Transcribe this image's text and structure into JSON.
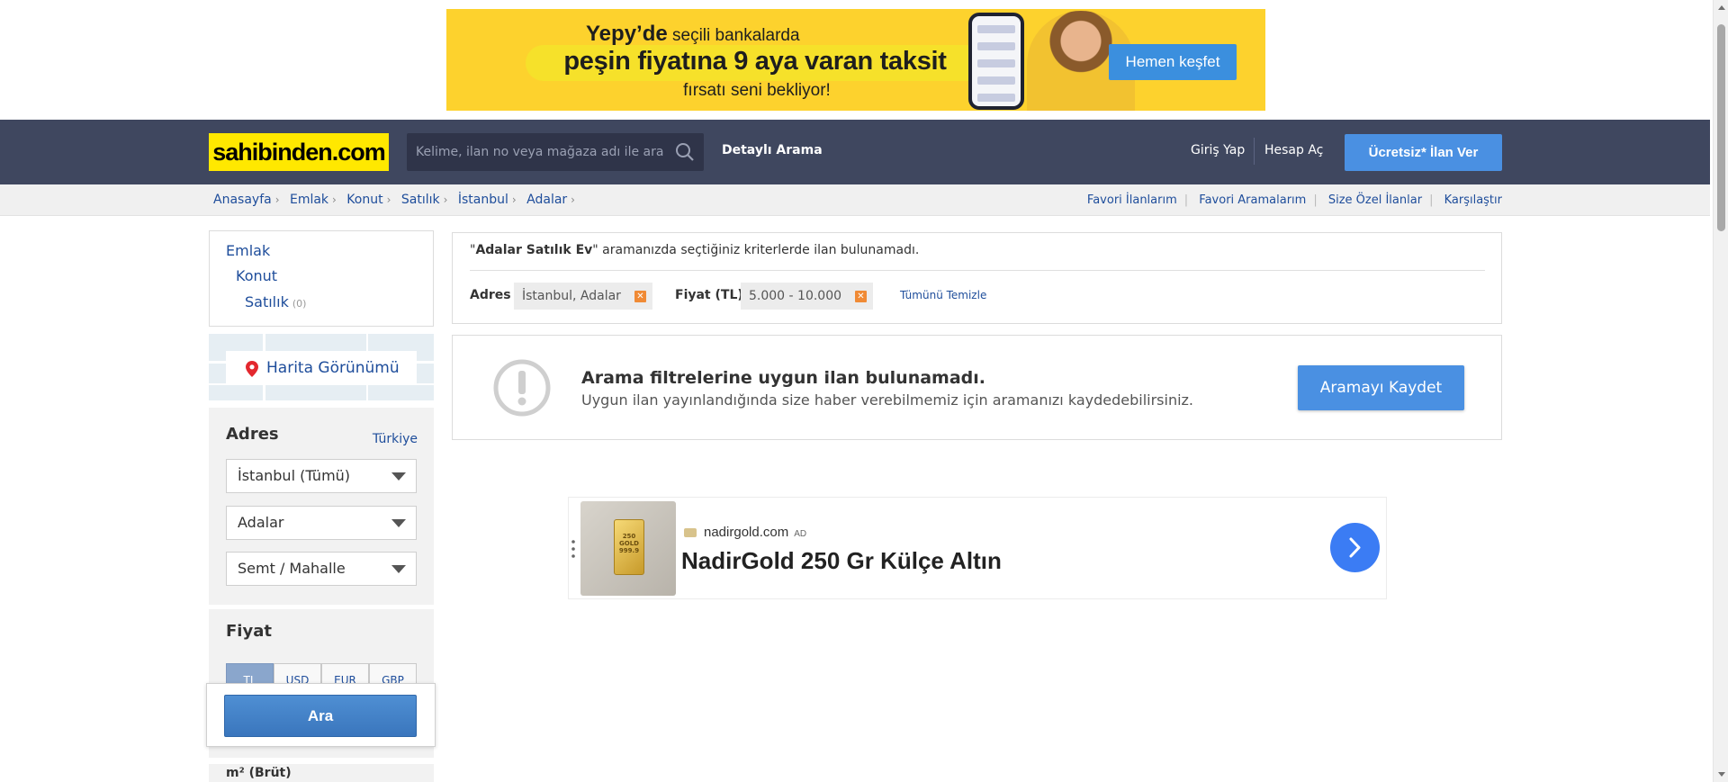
{
  "top_ad": {
    "line1_brand": "Yepy’de",
    "line1_rest": " seçili bankalarda",
    "line2": "peşin fiyatına 9 aya varan taksit",
    "line3": "fırsatı seni bekliyor!",
    "cta": "Hemen keşfet",
    "color": "#fdd22d"
  },
  "header": {
    "logo": "sahibinden.com",
    "search_placeholder": "Kelime, ilan no veya mağaza adı ile ara",
    "detailed_search": "Detaylı Arama",
    "login": "Giriş Yap",
    "register": "Hesap Aç",
    "post_ad": "Ücretsiz* İlan Ver",
    "bg_color": "#3f475f",
    "logo_color": "#ffe800"
  },
  "breadcrumb": [
    "Anasayfa",
    "Emlak",
    "Konut",
    "Satılık",
    "İstanbul",
    "Adalar"
  ],
  "quick_links": [
    "Favori İlanlarım",
    "Favori Aramalarım",
    "Size Özel İlanlar",
    "Karşılaştır"
  ],
  "sidebar": {
    "categories": {
      "level1": "Emlak",
      "level2": "Konut",
      "level3": "Satılık",
      "level3_count": "(0)"
    },
    "map_view": "Harita Görünümü",
    "address": {
      "title": "Adres",
      "country": "Türkiye",
      "city": "İstanbul (Tümü)",
      "district": "Adalar",
      "neighborhood": "Semt / Mahalle"
    },
    "price": {
      "title": "Fiyat",
      "currencies": [
        "TL",
        "USD",
        "EUR",
        "GBP"
      ],
      "selected_currency": "TL"
    },
    "search_button": "Ara",
    "next_section": "m² (Brüt)"
  },
  "results": {
    "query_prefix": "\"",
    "query_bold": "Adalar Satılık Ev",
    "query_suffix": "\" aramanızda seçtiğiniz kriterlerde ilan bulunamadı.",
    "filters": [
      {
        "label": "Adres",
        "value": "İstanbul, Adalar"
      },
      {
        "label": "Fiyat (TL)",
        "value": "5.000 - 10.000"
      }
    ],
    "clear_all": "Tümünü Temizle"
  },
  "empty_state": {
    "title": "Arama filtrelerine uygun ilan bulunamadı.",
    "subtitle": "Uygun ilan yayınlandığında size haber verebilmemiz için aramanızı kaydedebilirsiniz.",
    "save_button": "Aramayı Kaydet"
  },
  "ad_block": {
    "domain": "nadirgold.com",
    "ad_label": "AD",
    "title": "NadirGold 250 Gr Külçe Altın",
    "product_text": "250 GOLD 999.9"
  },
  "colors": {
    "link": "#1e4d9b",
    "primary_button": "#4a90e2",
    "chip_close": "#f08a35"
  }
}
